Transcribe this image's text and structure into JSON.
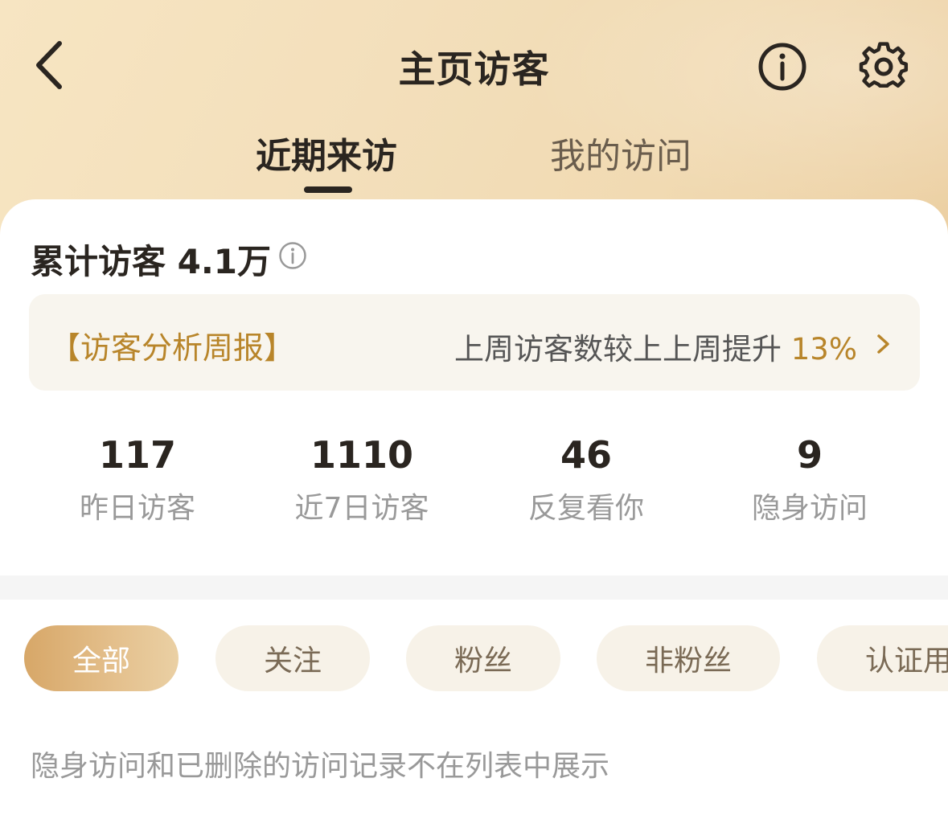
{
  "header": {
    "title": "主页访客"
  },
  "tabs": [
    {
      "label": "近期来访",
      "active": true
    },
    {
      "label": "我的访问",
      "active": false
    }
  ],
  "summary": {
    "total_label": "累计访客 4.1万"
  },
  "weekly_report": {
    "title": "【访客分析周报】",
    "description": "上周访客数较上上周提升",
    "percent": "13%"
  },
  "stats": [
    {
      "value": "117",
      "label": "昨日访客"
    },
    {
      "value": "1110",
      "label": "近7日访客"
    },
    {
      "value": "46",
      "label": "反复看你"
    },
    {
      "value": "9",
      "label": "隐身访问"
    }
  ],
  "filters": [
    {
      "label": "全部",
      "active": true
    },
    {
      "label": "关注",
      "active": false
    },
    {
      "label": "粉丝",
      "active": false
    },
    {
      "label": "非粉丝",
      "active": false
    },
    {
      "label": "认证用",
      "active": false
    }
  ],
  "footnote": "隐身访问和已删除的访问记录不在列表中展示",
  "colors": {
    "accent": "#b8852a",
    "header_gradient_start": "#f7e5c2",
    "header_gradient_end": "#ecd0a3",
    "chip_bg": "#f7f2e8",
    "chip_active_start": "#d7a768"
  }
}
